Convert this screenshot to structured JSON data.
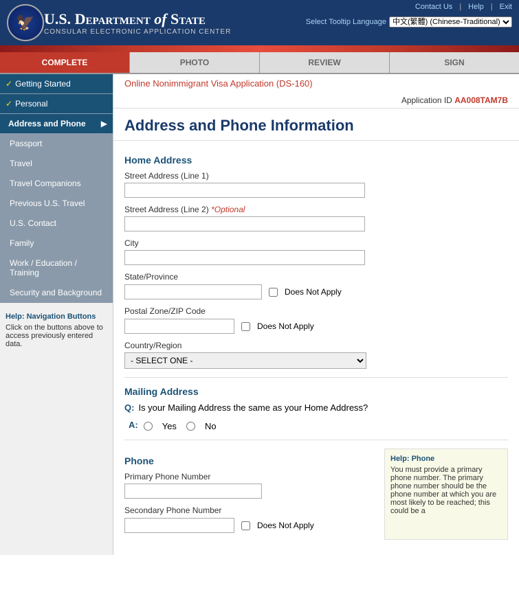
{
  "header": {
    "department": "U.S. Department",
    "of": "of",
    "state": "State",
    "subtitle": "CONSULAR ELECTRONIC APPLICATION CENTER",
    "links": [
      "Contact Us",
      "Help",
      "Exit"
    ],
    "lang_label": "Select Tooltip Language",
    "lang_value": "中文(繁體) (Chinese-Traditional)"
  },
  "nav": {
    "tabs": [
      {
        "label": "COMPLETE",
        "state": "active"
      },
      {
        "label": "PHOTO",
        "state": "inactive"
      },
      {
        "label": "REVIEW",
        "state": "inactive"
      },
      {
        "label": "SIGN",
        "state": "inactive"
      }
    ]
  },
  "sidebar": {
    "items": [
      {
        "label": "Getting Started",
        "check": true,
        "sub": false,
        "active": false
      },
      {
        "label": "Personal",
        "check": true,
        "sub": false,
        "active": false
      },
      {
        "label": "Address and Phone",
        "check": false,
        "sub": true,
        "active": true,
        "arrow": true
      },
      {
        "label": "Passport",
        "check": false,
        "sub": true,
        "active": false
      },
      {
        "label": "Travel",
        "check": false,
        "sub": true,
        "active": false
      },
      {
        "label": "Travel Companions",
        "check": false,
        "sub": true,
        "active": false
      },
      {
        "label": "Previous U.S. Travel",
        "check": false,
        "sub": true,
        "active": false
      },
      {
        "label": "U.S. Contact",
        "check": false,
        "sub": true,
        "active": false
      },
      {
        "label": "Family",
        "check": false,
        "sub": true,
        "active": false
      },
      {
        "label": "Work / Education / Training",
        "check": false,
        "sub": true,
        "active": false
      },
      {
        "label": "Security and Background",
        "check": false,
        "sub": true,
        "active": false
      }
    ],
    "help_title": "Help:",
    "help_subtitle": "Navigation Buttons",
    "help_text": "Click on the buttons above to access previously entered data."
  },
  "page": {
    "app_link": "Online Nonimmigrant Visa Application (DS-160)",
    "app_id_label": "Application ID",
    "app_id": "AA008TAM7B",
    "title": "Address and Phone Information"
  },
  "home_address": {
    "section_title": "Home Address",
    "street1_label": "Street Address (Line 1)",
    "street1_value": "",
    "street2_label": "Street Address (Line 2)",
    "street2_optional": "*Optional",
    "street2_value": "",
    "city_label": "City",
    "city_value": "",
    "state_label": "State/Province",
    "state_value": "",
    "state_dna": "Does Not Apply",
    "postal_label": "Postal Zone/ZIP Code",
    "postal_value": "",
    "postal_dna": "Does Not Apply",
    "country_label": "Country/Region",
    "country_value": "- SELECT ONE -"
  },
  "mailing_address": {
    "section_title": "Mailing Address",
    "question": "Is your Mailing Address the same as your Home Address?",
    "q_label": "Q:",
    "a_label": "A:",
    "yes_label": "Yes",
    "no_label": "No"
  },
  "phone": {
    "section_title": "Phone",
    "primary_label": "Primary Phone Number",
    "primary_value": "",
    "secondary_label": "Secondary Phone Number",
    "secondary_value": "",
    "secondary_dna": "Does Not Apply",
    "help_title": "Help:",
    "help_subtitle": "Phone",
    "help_text": "You must provide a primary phone number. The primary phone number should be the phone number at which you are most likely to be reached; this could be a"
  }
}
